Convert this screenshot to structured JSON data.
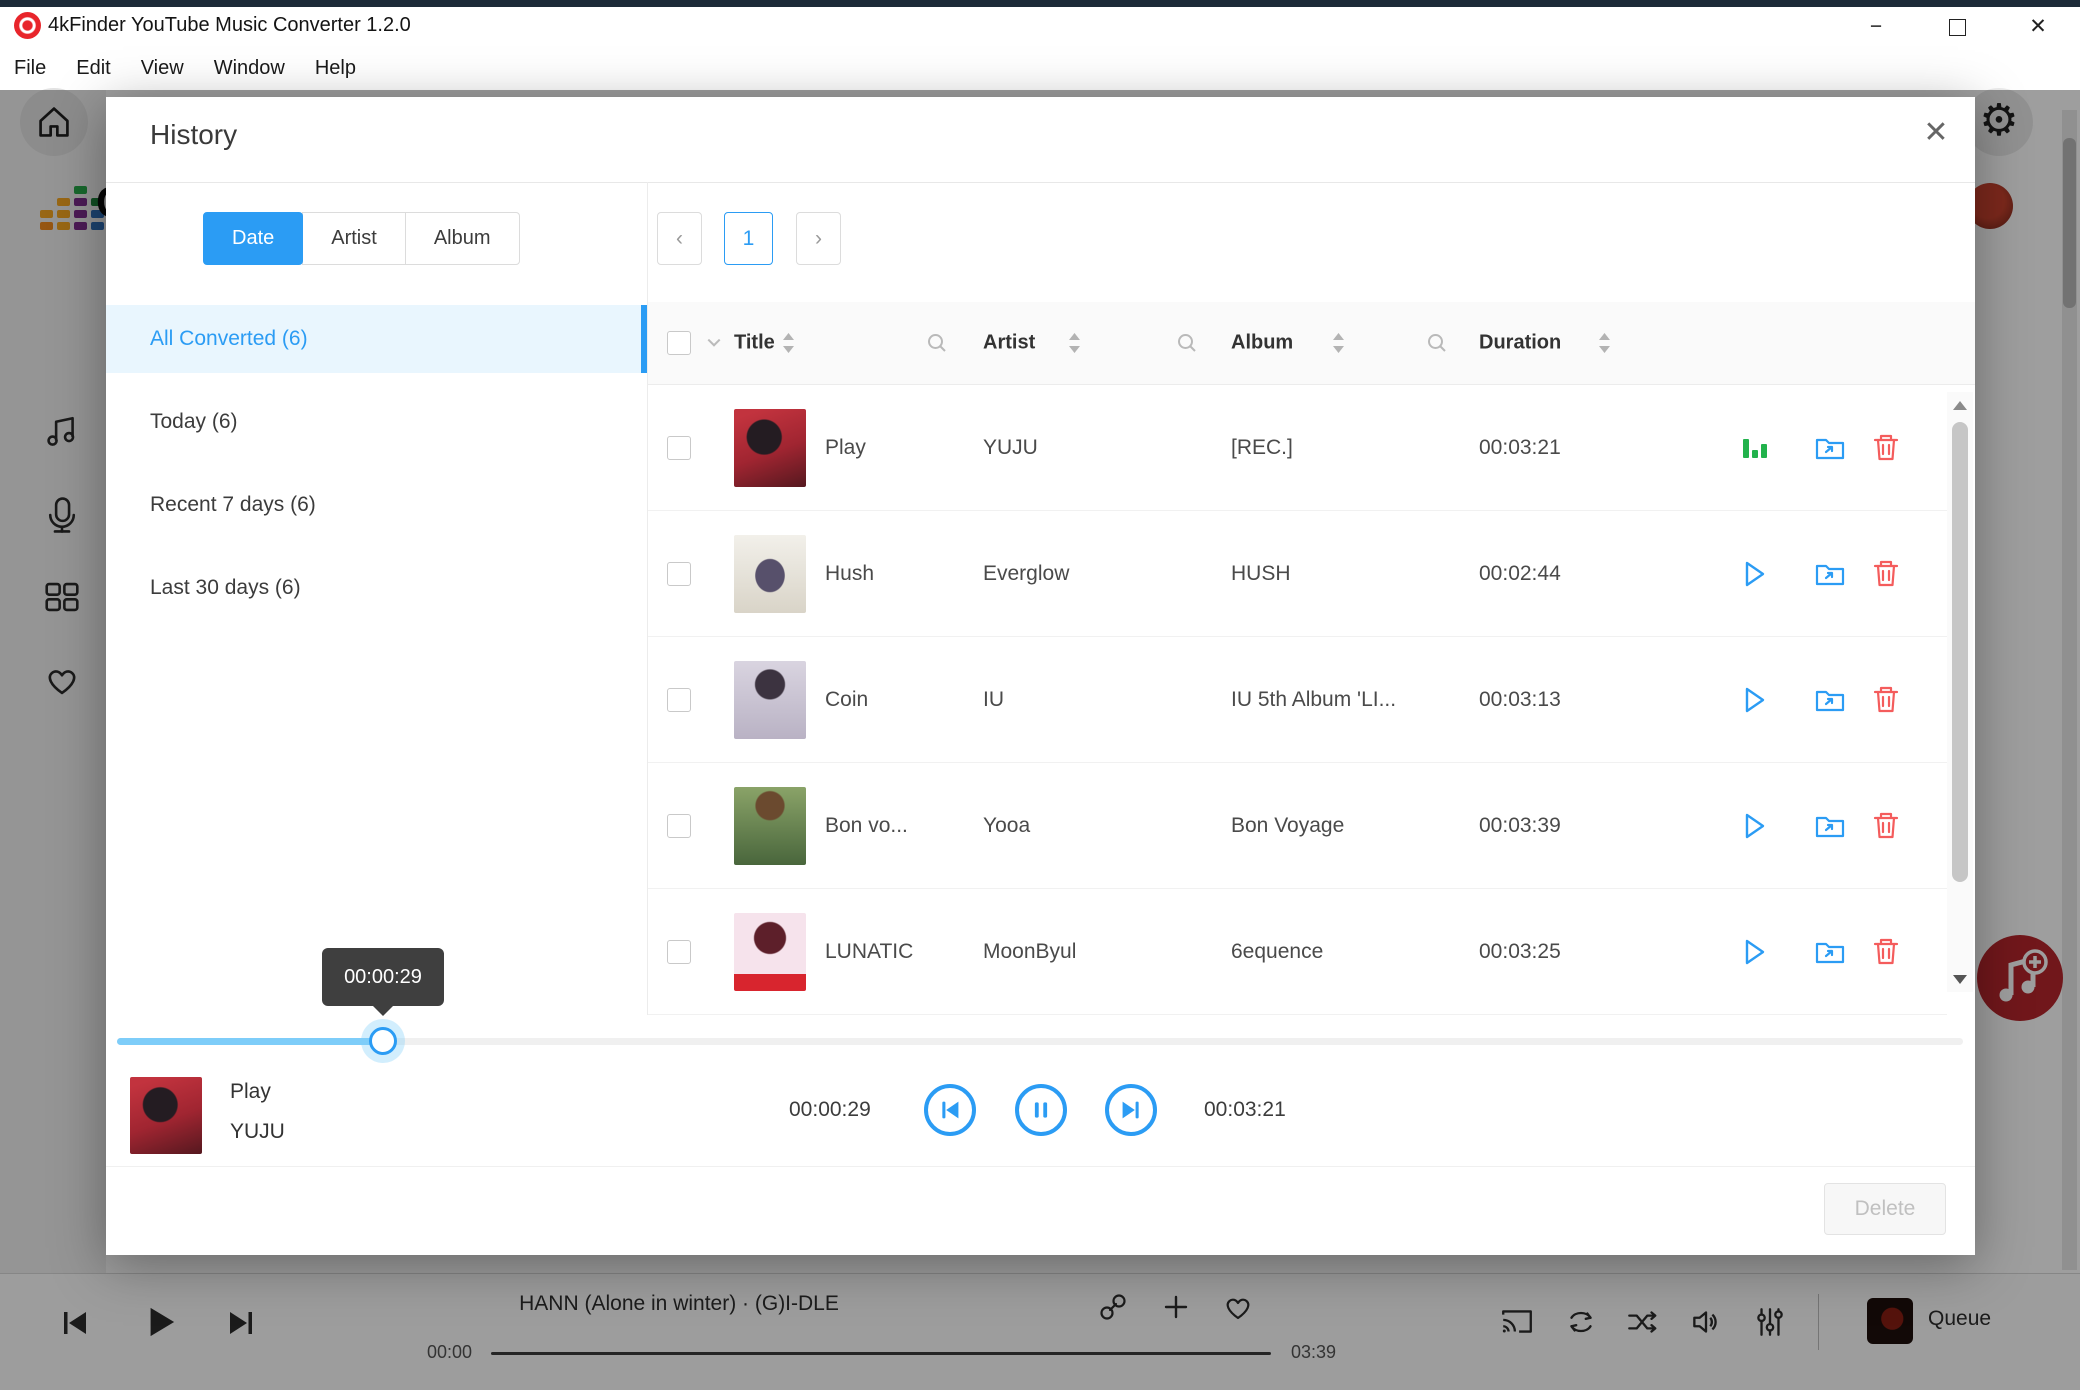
{
  "window": {
    "title": "4kFinder YouTube Music Converter 1.2.0",
    "menu": [
      "File",
      "Edit",
      "View",
      "Window",
      "Help"
    ]
  },
  "modal": {
    "title": "History",
    "tabs": [
      {
        "label": "Date",
        "active": true
      },
      {
        "label": "Artist",
        "active": false
      },
      {
        "label": "Album",
        "active": false
      }
    ],
    "nav": [
      {
        "label": "All Converted (6)",
        "active": true
      },
      {
        "label": "Today (6)",
        "active": false
      },
      {
        "label": "Recent 7 days (6)",
        "active": false
      },
      {
        "label": "Last 30 days (6)",
        "active": false
      }
    ],
    "pagination": {
      "page": "1"
    },
    "table": {
      "columns": [
        "Title",
        "Artist",
        "Album",
        "Duration"
      ],
      "rows": [
        {
          "title": "Play",
          "artist": "YUJU",
          "album": "[REC.]",
          "duration": "00:03:21",
          "status": "playing"
        },
        {
          "title": "Hush",
          "artist": "Everglow",
          "album": "HUSH",
          "duration": "00:02:44",
          "status": "idle"
        },
        {
          "title": "Coin",
          "artist": "IU",
          "album": "IU 5th Album 'LI...",
          "duration": "00:03:13",
          "status": "idle"
        },
        {
          "title": "Bon vo...",
          "artist": "Yooa",
          "album": "Bon Voyage",
          "duration": "00:03:39",
          "status": "idle"
        },
        {
          "title": "LUNATIC",
          "artist": "MoonByul",
          "album": "6equence",
          "duration": "00:03:25",
          "status": "idle"
        }
      ]
    },
    "player": {
      "tooltip": "00:00:29",
      "track_title": "Play",
      "track_artist": "YUJU",
      "elapsed": "00:00:29",
      "duration": "00:03:21"
    },
    "delete_label": "Delete"
  },
  "player_bar": {
    "track": "HANN (Alone in winter) · (G)I-DLE",
    "elapsed": "00:00",
    "duration": "03:39",
    "queue_label": "Queue"
  },
  "colors": {
    "accent": "#2b9cf4",
    "playing_green": "#22b24c",
    "danger": "#f45c5c"
  }
}
